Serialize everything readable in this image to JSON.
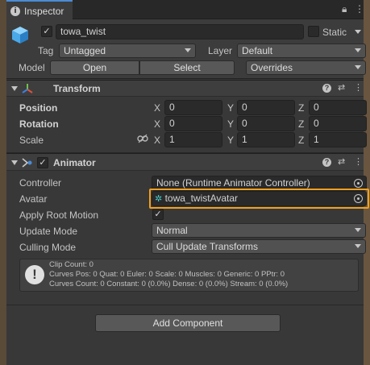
{
  "tab": {
    "title": "Inspector",
    "icon": "info-icon",
    "lock_icon": "lock-icon",
    "menu_icon": "kebab-menu-icon"
  },
  "object": {
    "name": "towa_twist",
    "active": true,
    "static_label": "Static",
    "tag_label": "Tag",
    "tag_value": "Untagged",
    "layer_label": "Layer",
    "layer_value": "Default",
    "model_label": "Model",
    "open_button": "Open",
    "select_button": "Select",
    "overrides_value": "Overrides"
  },
  "transform": {
    "title": "Transform",
    "rows": [
      {
        "label": "Position",
        "x": "0",
        "y": "0",
        "z": "0"
      },
      {
        "label": "Rotation",
        "x": "0",
        "y": "0",
        "z": "0"
      },
      {
        "label": "Scale",
        "x": "1",
        "y": "1",
        "z": "1"
      }
    ],
    "axis_x": "X",
    "axis_y": "Y",
    "axis_z": "Z"
  },
  "animator": {
    "title": "Animator",
    "enabled": true,
    "controller_label": "Controller",
    "controller_value": "None (Runtime Animator Controller)",
    "avatar_label": "Avatar",
    "avatar_value": "towa_twistAvatar",
    "apply_root_motion_label": "Apply Root Motion",
    "apply_root_motion": true,
    "update_mode_label": "Update Mode",
    "update_mode_value": "Normal",
    "culling_mode_label": "Culling Mode",
    "culling_mode_value": "Cull Update Transforms",
    "help_lines": [
      "Clip Count: 0",
      "Curves Pos: 0 Quat: 0 Euler: 0 Scale: 0 Muscles: 0 Generic: 0 PPtr: 0",
      "Curves Count: 0 Constant: 0 (0.0%) Dense: 0 (0.0%) Stream: 0 (0.0%)"
    ]
  },
  "add_component_button": "Add Component",
  "colors": {
    "highlight": "#f0a020",
    "tab_accent": "#4a8bd6"
  }
}
